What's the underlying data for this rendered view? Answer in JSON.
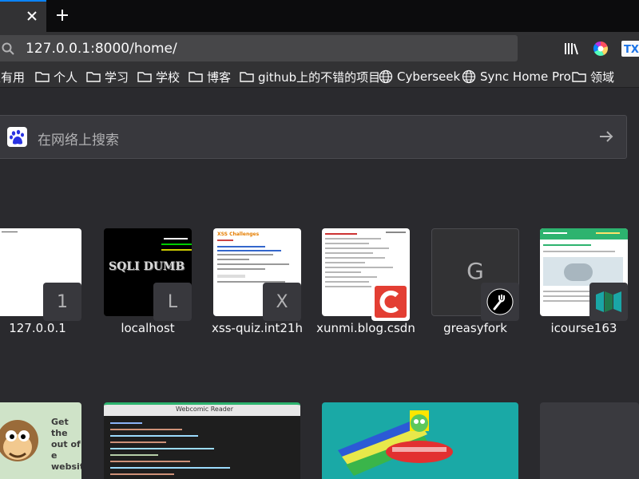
{
  "browser": {
    "url": "127.0.0.1:8000/home/",
    "accent_color": "#0a84ff"
  },
  "toolbar_icons": [
    "library-icon",
    "extension-icon-color-wheel",
    "extension-icon-tx"
  ],
  "bookmarks": [
    {
      "label": "很有用",
      "icon": "folder-icon"
    },
    {
      "label": "个人",
      "icon": "folder-icon"
    },
    {
      "label": "学习",
      "icon": "folder-icon"
    },
    {
      "label": "学校",
      "icon": "folder-icon"
    },
    {
      "label": "博客",
      "icon": "folder-icon"
    },
    {
      "label": "github上的不错的项目",
      "icon": "folder-icon"
    },
    {
      "label": "Cyberseek",
      "icon": "globe-icon"
    },
    {
      "label": "Sync Home Pro",
      "icon": "globe-icon"
    },
    {
      "label": "领域",
      "icon": "folder-icon"
    }
  ],
  "search": {
    "placeholder": "在网络上搜索",
    "engine_icon": "baidu-paw-icon"
  },
  "top_sites": [
    {
      "label": "127.0.0.1",
      "badge": "1"
    },
    {
      "label": "localhost",
      "badge": "L",
      "thumb_text": "SQLI DUMB"
    },
    {
      "label": "xss-quiz.int21h",
      "badge": "X",
      "thumb_title": "XSS Challenges"
    },
    {
      "label": "xunmi.blog.csdn",
      "badge": "C"
    },
    {
      "label": "greasyfork",
      "badge": "G"
    },
    {
      "label": "icourse163",
      "badge": ""
    }
  ],
  "row2_thumbs": {
    "monkey_text": "Get the out of e website",
    "webcomic_title": "Webcomic Reader"
  }
}
